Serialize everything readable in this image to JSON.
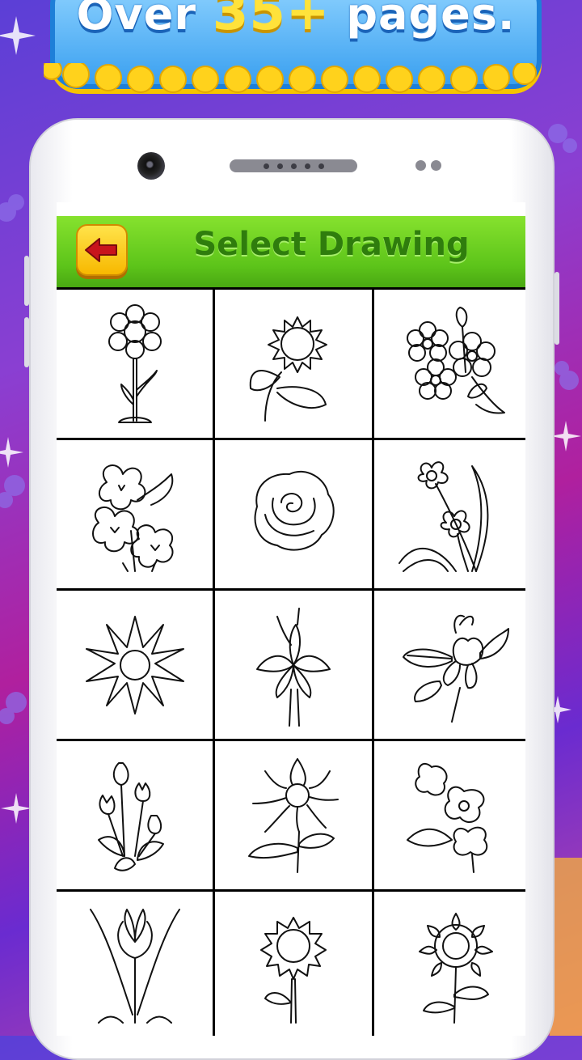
{
  "promo": {
    "before": "Over",
    "highlight": "35+",
    "after": "pages."
  },
  "header": {
    "title": "Select Drawing"
  },
  "colors": {
    "header_green": "#5dc41a",
    "back_button_yellow": "#f7b800",
    "back_arrow_red": "#c8141c",
    "banner_blue": "#3aa0f0"
  },
  "drawings": [
    {
      "icon": "daisy-flower-icon"
    },
    {
      "icon": "sunflower-leaves-icon"
    },
    {
      "icon": "flower-bouquet-icon"
    },
    {
      "icon": "pansy-flowers-icon"
    },
    {
      "icon": "rose-icon"
    },
    {
      "icon": "daffodil-icon"
    },
    {
      "icon": "dahlia-icon"
    },
    {
      "icon": "lily-icon"
    },
    {
      "icon": "magnolia-icon"
    },
    {
      "icon": "crocus-bunch-icon"
    },
    {
      "icon": "zinnia-icon"
    },
    {
      "icon": "orchid-icon"
    },
    {
      "icon": "tulip-icon"
    },
    {
      "icon": "sunflower-icon"
    },
    {
      "icon": "gerbera-icon"
    }
  ]
}
